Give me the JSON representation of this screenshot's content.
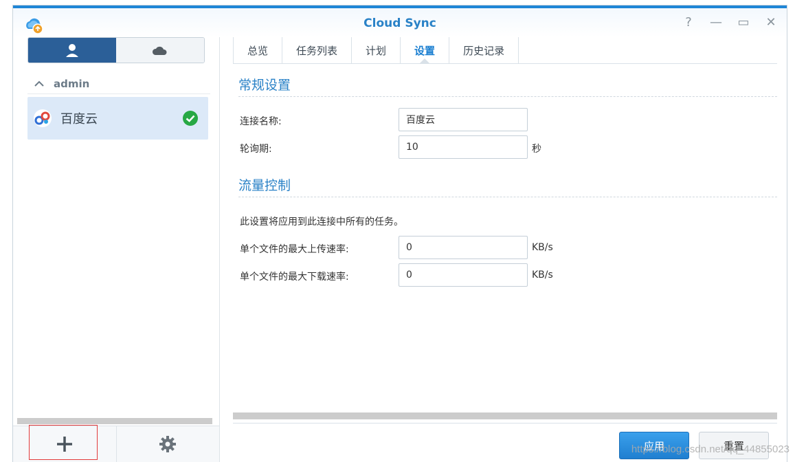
{
  "window": {
    "title": "Cloud Sync"
  },
  "sidebar": {
    "group_label": "admin",
    "connection": {
      "name": "百度云",
      "status": "synced"
    }
  },
  "tabs": [
    {
      "label": "总览"
    },
    {
      "label": "任务列表"
    },
    {
      "label": "计划"
    },
    {
      "label": "设置",
      "active": true
    },
    {
      "label": "历史记录"
    }
  ],
  "general": {
    "title": "常规设置",
    "connection_name_label": "连接名称:",
    "connection_name_value": "百度云",
    "poll_label": "轮询期:",
    "poll_value": "10",
    "poll_unit": "秒"
  },
  "traffic": {
    "title": "流量控制",
    "note": "此设置将应用到此连接中所有的任务。",
    "upload_label": "单个文件的最大上传速率:",
    "upload_value": "0",
    "upload_unit": "KB/s",
    "download_label": "单个文件的最大下载速率:",
    "download_value": "0",
    "download_unit": "KB/s"
  },
  "buttons": {
    "apply": "应用",
    "reset": "重置"
  },
  "watermark": "https://blog.csdn.net/qq_44855023",
  "colors": {
    "accent": "#2a82c7",
    "active_tab": "#1b7fd1",
    "selected_bg": "#dce9f8"
  }
}
